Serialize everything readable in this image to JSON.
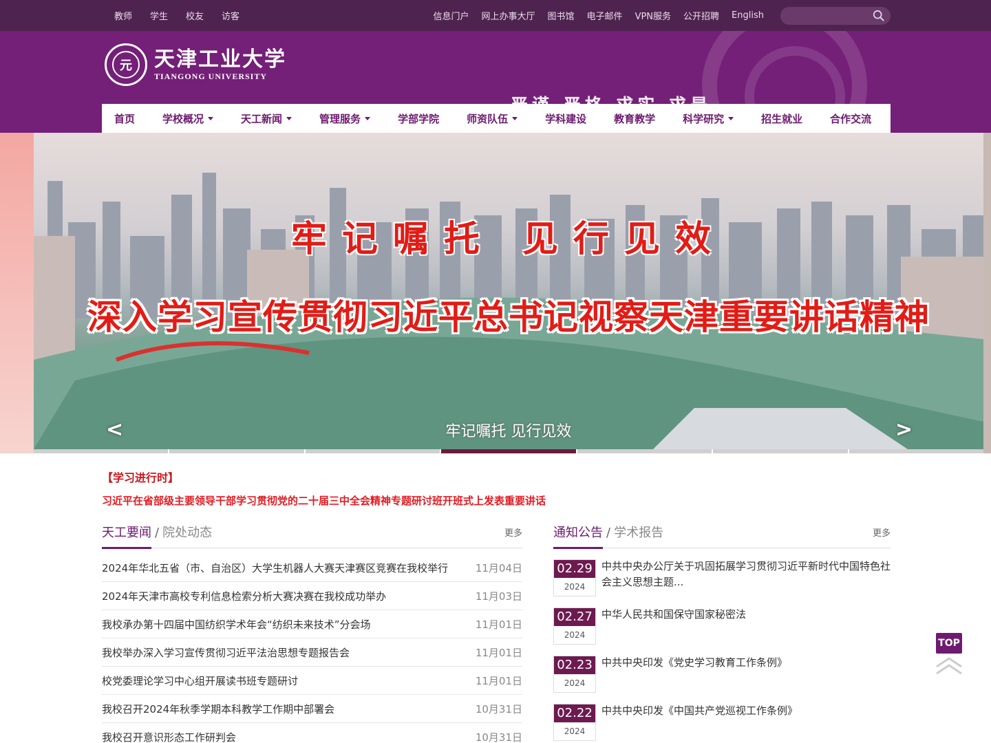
{
  "topbar": {
    "roles": [
      "教师",
      "学生",
      "校友",
      "访客"
    ],
    "links": [
      "信息门户",
      "网上办事大厅",
      "图书馆",
      "电子邮件",
      "VPN服务",
      "公开招聘",
      "English"
    ],
    "search_placeholder": ""
  },
  "header": {
    "logo_seal_text": "元",
    "logo_cn": "天津工业大学",
    "logo_en": "TIANGONG UNIVERSITY",
    "motto": "严谨 严格 求实 求是"
  },
  "nav": [
    {
      "label": "首页",
      "dropdown": false
    },
    {
      "label": "学校概况",
      "dropdown": true
    },
    {
      "label": "天工新闻",
      "dropdown": true
    },
    {
      "label": "管理服务",
      "dropdown": true
    },
    {
      "label": "学部学院",
      "dropdown": false
    },
    {
      "label": "师资队伍",
      "dropdown": true
    },
    {
      "label": "学科建设",
      "dropdown": false
    },
    {
      "label": "教育教学",
      "dropdown": false
    },
    {
      "label": "科学研究",
      "dropdown": true
    },
    {
      "label": "招生就业",
      "dropdown": false
    },
    {
      "label": "合作交流",
      "dropdown": false
    }
  ],
  "banner": {
    "slogan_line1": "牢记嘱托 见行见效",
    "slogan_line2": "深入学习宣传贯彻习近平总书记视察天津重要讲话精神",
    "caption": "牢记嘱托 见行见效",
    "prev_label": "<",
    "next_label": ">",
    "slide_count": 7,
    "active_slide": 4
  },
  "study": {
    "tag": "【学习进行时】",
    "title": "习近平在省部级主要领导干部学习贯彻党的二十届三中全会精神专题研讨班开班式上发表重要讲话"
  },
  "news": {
    "tab_active": "天工要闻",
    "separator": "/",
    "tab_other": "院处动态",
    "more": "更多",
    "items": [
      {
        "title": "2024年华北五省（市、自治区）大学生机器人大赛天津赛区竞赛在我校举行",
        "date": "11月04日"
      },
      {
        "title": "2024年天津市高校专利信息检索分析大赛决赛在我校成功举办",
        "date": "11月03日"
      },
      {
        "title": "我校承办第十四届中国纺织学术年会“纺织未来技术”分会场",
        "date": "11月01日"
      },
      {
        "title": "我校举办深入学习宣传贯彻习近平法治思想专题报告会",
        "date": "11月01日"
      },
      {
        "title": "校党委理论学习中心组开展读书班专题研讨",
        "date": "11月01日"
      },
      {
        "title": "我校召开2024年秋季学期本科教学工作期中部署会",
        "date": "10月31日"
      },
      {
        "title": "我校召开意识形态工作研判会",
        "date": "10月31日"
      }
    ]
  },
  "notices": {
    "tab_active": "通知公告",
    "separator": "/",
    "tab_other": "学术报告",
    "more": "更多",
    "items": [
      {
        "md": "02.29",
        "year": "2024",
        "title": "中共中央办公厅关于巩固拓展学习贯彻习近平新时代中国特色社会主义思想主题..."
      },
      {
        "md": "02.27",
        "year": "2024",
        "title": "中华人民共和国保守国家秘密法"
      },
      {
        "md": "02.23",
        "year": "2024",
        "title": "中共中央印发《党史学习教育工作条例》"
      },
      {
        "md": "02.22",
        "year": "2024",
        "title": "中共中央印发《中国共产党巡视工作条例》"
      }
    ]
  },
  "top_button": "TOP",
  "colors": {
    "brand": "#741f78",
    "topbar": "#4f2350",
    "alert_red": "#e11b22"
  }
}
